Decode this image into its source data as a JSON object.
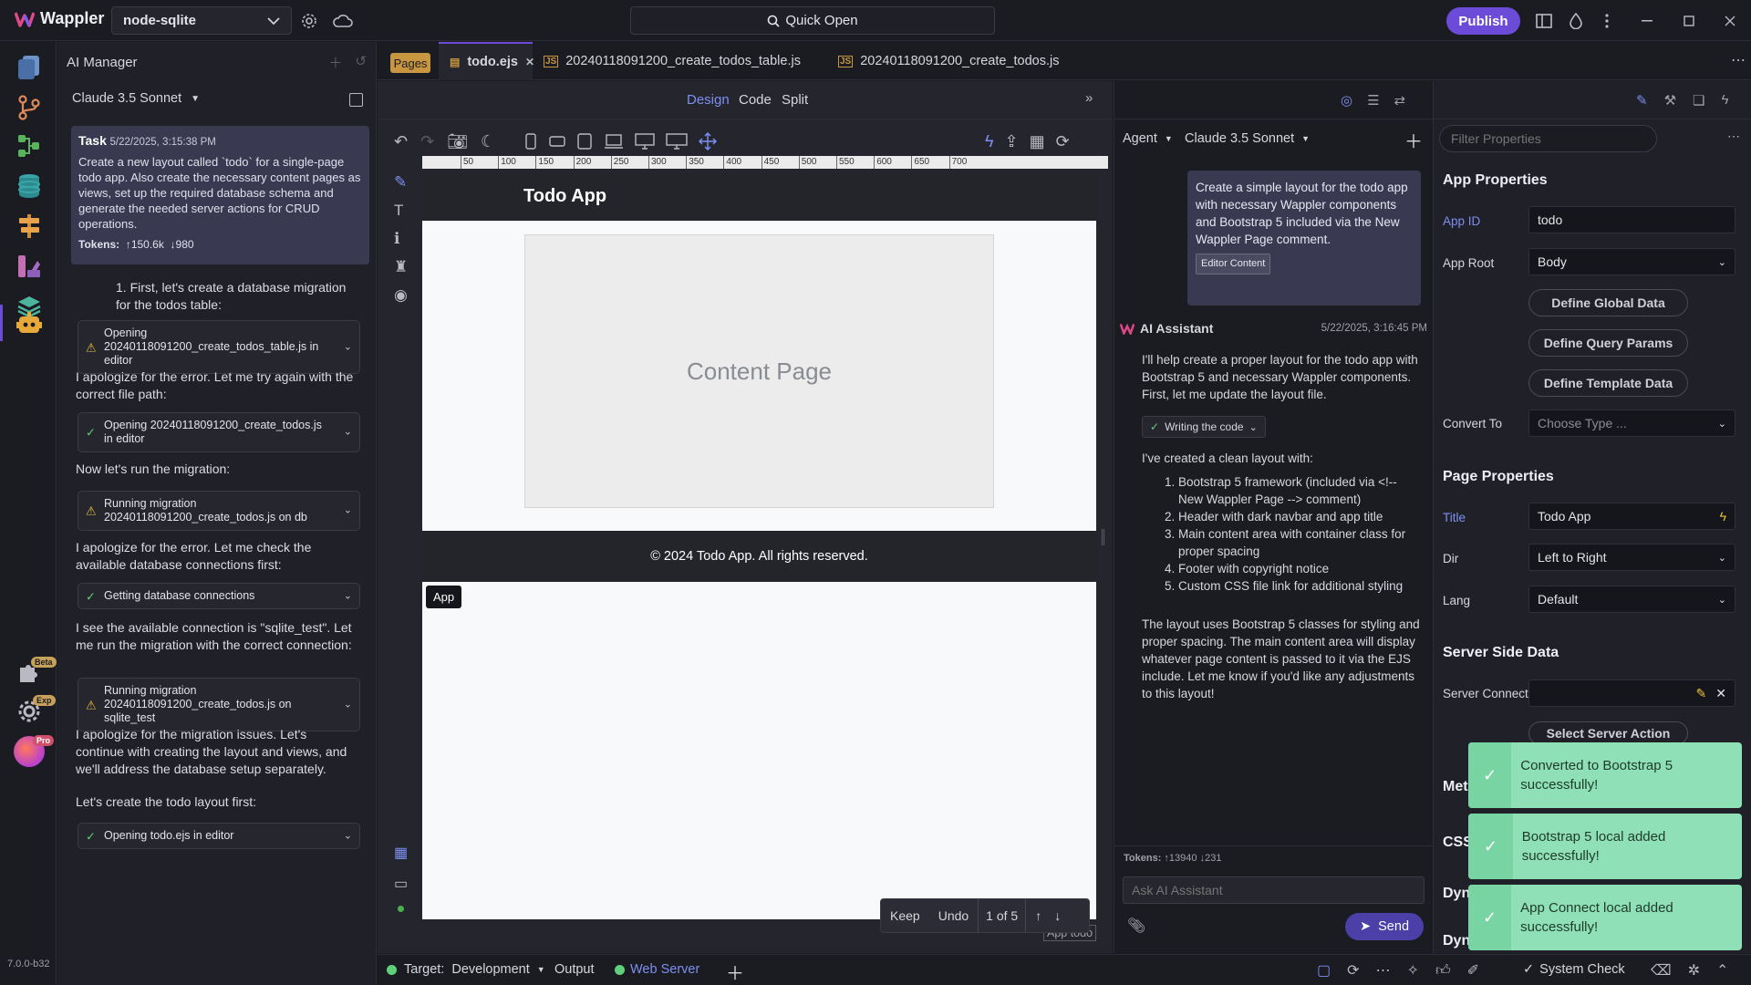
{
  "app": {
    "name": "Wappler",
    "version": "7.0.0-b32"
  },
  "top": {
    "project": "node-sqlite",
    "quick_open": "Quick Open",
    "publish": "Publish"
  },
  "rail": {
    "beta": "Beta",
    "exp": "Exp",
    "pro": "Pro"
  },
  "ai_manager": {
    "title": "AI Manager",
    "model": "Claude 3.5 Sonnet",
    "task": {
      "label": "Task",
      "time": "5/22/2025, 3:15:38 PM",
      "text": "Create a new layout called `todo` for a single-page todo app. Also create the necessary content pages as views, set up the required database schema and generate the needed server actions for CRUD operations.",
      "tokens_label": "Tokens:",
      "tokens_up": "150.6k",
      "tokens_down": "980"
    },
    "messages": [
      "1. First, let's create a database migration for the todos table:",
      "I apologize for the error. Let me try again with the correct file path:",
      "Now let's run the migration:",
      "I apologize for the error. Let me check the available database connections first:",
      "I see the available connection is \"sqlite_test\". Let me run the migration with the correct connection:",
      "I apologize for the migration issues. Let's continue with creating the layout and views, and we'll address the database setup separately.",
      "Let's create the todo layout first:"
    ],
    "steps": [
      {
        "text": "Opening 20240118091200_create_todos_table.js in editor",
        "status": "warn"
      },
      {
        "text": "Opening 20240118091200_create_todos.js in editor",
        "status": "ok"
      },
      {
        "text": "Running migration 20240118091200_create_todos.js on db",
        "status": "warn"
      },
      {
        "text": "Getting database connections",
        "status": "ok"
      },
      {
        "text": "Running migration 20240118091200_create_todos.js on sqlite_test",
        "status": "warn"
      },
      {
        "text": "Opening todo.ejs in editor",
        "status": "ok"
      }
    ]
  },
  "tabs": {
    "pages": "Pages",
    "items": [
      {
        "label": "todo.ejs",
        "active": true
      },
      {
        "label": "20240118091200_create_todos_table.js",
        "active": false
      },
      {
        "label": "20240118091200_create_todos.js",
        "active": false
      }
    ]
  },
  "design": {
    "modes": [
      "Design",
      "Code",
      "Split"
    ],
    "ruler": [
      "50",
      "100",
      "150",
      "200",
      "250",
      "300",
      "350",
      "400",
      "450",
      "500",
      "550",
      "600",
      "650",
      "700"
    ],
    "page_title": "Todo App",
    "content": "Content Page",
    "footer": "© 2024 Todo App. All rights reserved.",
    "app_tag": "App",
    "app_todo": "App todo",
    "review": {
      "keep": "Keep",
      "undo": "Undo",
      "count": "1 of 5"
    }
  },
  "chat": {
    "mode": "Agent",
    "model": "Claude 3.5 Sonnet",
    "user_msg": "Create a simple layout for the todo app with necessary Wappler components and Bootstrap 5 included via the New Wappler Page comment.",
    "editor_content": "Editor Content",
    "assistant": "AI Assistant",
    "assistant_time": "5/22/2025, 3:16:45 PM",
    "intro": "I'll help create a proper layout for the todo app with Bootstrap 5 and necessary Wappler components. First, let me update the layout file.",
    "writing": "Writing the code",
    "created": "I've created a clean layout with:",
    "list": [
      "Bootstrap 5 framework (included via <!-- New Wappler Page --> comment)",
      "Header with dark navbar and app title",
      "Main content area with container class for proper spacing",
      "Footer with copyright notice",
      "Custom CSS file link for additional styling"
    ],
    "outro": "The layout uses Bootstrap 5 classes for styling and proper spacing. The main content area will display whatever page content is passed to it via the EJS include. Let me know if you'd like any adjustments to this layout!",
    "tokens_label": "Tokens:",
    "tokens_up": "13940",
    "tokens_down": "231",
    "placeholder": "Ask AI Assistant",
    "send": "Send"
  },
  "props": {
    "filter_placeholder": "Filter Properties",
    "app_props": "App Properties",
    "app_id_label": "App ID",
    "app_id": "todo",
    "app_root_label": "App Root",
    "app_root": "Body",
    "btn_global": "Define Global Data",
    "btn_query": "Define Query Params",
    "btn_template": "Define Template Data",
    "convert_label": "Convert To",
    "convert_placeholder": "Choose Type ...",
    "page_props": "Page Properties",
    "title_label": "Title",
    "title": "Todo App",
    "dir_label": "Dir",
    "dir": "Left to Right",
    "lang_label": "Lang",
    "lang": "Default",
    "ssd": "Server Side Data",
    "sc_label": "Server Connect",
    "select_action": "Select Server Action",
    "cut1": "Met",
    "cut2": "CSS",
    "cut3": "Dyn",
    "cut4": "Dyn"
  },
  "toasts": [
    "Converted to Bootstrap 5 successfully!",
    "Bootstrap 5 local added successfully!",
    "App Connect local added successfully!"
  ],
  "status": {
    "target_label": "Target:",
    "target": "Development",
    "output": "Output",
    "web_server": "Web Server",
    "system_check": "System Check"
  },
  "colors": {
    "accent": "#6c4bd8",
    "warn": "#f0c23a",
    "ok": "#5fd07a",
    "toast": "#8fe0b6"
  }
}
